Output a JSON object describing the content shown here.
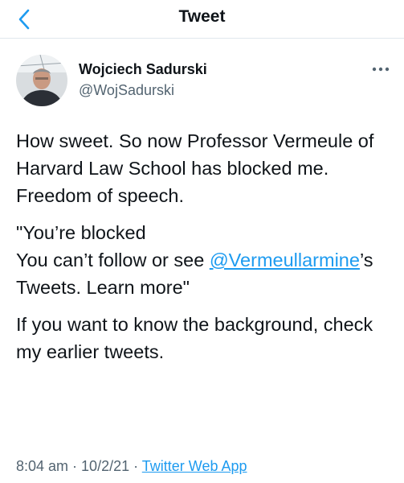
{
  "header": {
    "title": "Tweet",
    "back_icon": "chevron-left-icon",
    "accent_color": "#1d9bf0"
  },
  "author": {
    "name": "Wojciech Sadurski",
    "handle": "@WojSadurski",
    "more_icon": "more-horizontal-icon"
  },
  "tweet": {
    "paragraph1": "How sweet. So now Professor Vermeule of Harvard Law School has blocked me. Freedom of speech.",
    "quote_line1": "\"You’re blocked",
    "quote_line2_prefix": "You can’t follow or see ",
    "quote_link": "@Vermeullarmine",
    "quote_line2_suffix": "’s Tweets. Learn more\"",
    "paragraph3": "If you want to know the background, check my earlier tweets."
  },
  "meta": {
    "time": "8:04 am",
    "separator1": " · ",
    "date": "10/2/21",
    "separator2": " · ",
    "app": "Twitter Web App"
  }
}
